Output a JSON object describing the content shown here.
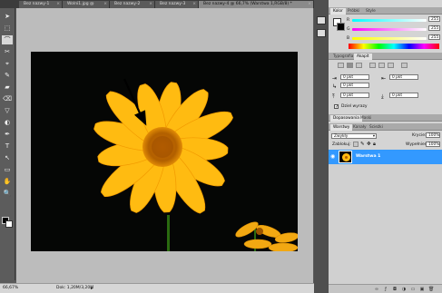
{
  "tabs": [
    {
      "label": "Bez nazwy-1"
    },
    {
      "label": "Wolni1.jpg @"
    },
    {
      "label": "Bez nazwy-2"
    },
    {
      "label": "Bez nazwy-3"
    },
    {
      "label": "Bez nazwy-4 @ 66,7% (Warstwa 1,RGB/8) *"
    }
  ],
  "tab_close": "×",
  "tools": [
    "➤",
    "⬚",
    "⌒",
    "✂",
    "⌖",
    "✎",
    "▰",
    "⌫",
    "▽",
    "◐",
    "✒",
    "T",
    "↖",
    "▭",
    "✋",
    "🔍"
  ],
  "status": {
    "zoom": "66,67%",
    "doc": "Dok: 1,20M/3,20M"
  },
  "color_panel": {
    "tabs": [
      "Kolor",
      "Próbki",
      "Style"
    ],
    "channels": [
      {
        "label": "R",
        "value": "255"
      },
      {
        "label": "G",
        "value": "255"
      },
      {
        "label": "B",
        "value": "255"
      }
    ]
  },
  "paragraph_panel": {
    "tabs": [
      "Typografia",
      "Akapit"
    ],
    "fields": [
      "0 pkt",
      "0 pkt",
      "0 pkt",
      "0 pkt",
      "0 pkt"
    ],
    "hyphen_label": "Dziel wyrazy"
  },
  "adjust_panel": {
    "tabs": [
      "Dopasowania",
      "Maski"
    ]
  },
  "layers_panel": {
    "tabs": [
      "Warstwy",
      "Kanały",
      "Ścieżki"
    ],
    "blend_mode": "Zwykły",
    "opacity_label": "Krycie:",
    "opacity_value": "100%",
    "lock_label": "Zablokuj:",
    "fill_label": "Wypełnienie:",
    "fill_value": "100%",
    "layers": [
      {
        "name": "Warstwa 1"
      }
    ]
  },
  "colors": {
    "accent": "#3399ff",
    "petal": "#ffbb11",
    "background": "#050605"
  }
}
